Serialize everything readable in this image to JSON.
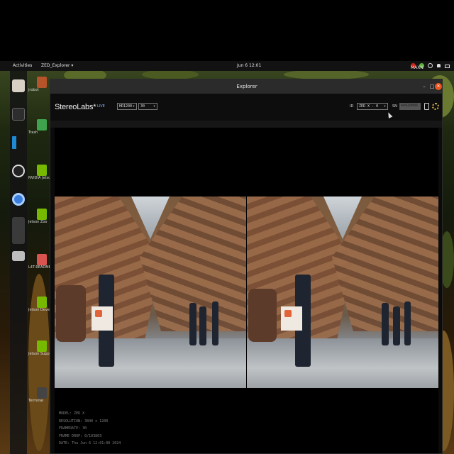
{
  "topbar": {
    "activities": "Activities",
    "app_menu": "ZED_Explorer ▾",
    "clock": "Jun 6  12:01",
    "power_mode": "MAXN"
  },
  "dock": {
    "items": [
      "files-icon",
      "terminal-icon",
      "vscode-icon",
      "obs-icon",
      "chromium-icon",
      "app-icon",
      "drive-icon"
    ]
  },
  "desktop_icons": [
    {
      "label": "jrobot",
      "color": "#c75b2b"
    },
    {
      "label": "Trash",
      "color": "#3fa34d"
    },
    {
      "label": "NVIDIA Jetson Community",
      "color": "#76b900"
    },
    {
      "label": "Jetson Zoo",
      "color": "#76b900"
    },
    {
      "label": "L4T-README",
      "color": "#d9534f"
    },
    {
      "label": "Jetson Developer Z",
      "color": "#76b900"
    },
    {
      "label": "Jetson Support Forums",
      "color": "#76b900"
    },
    {
      "label": "Terminal",
      "color": "#444444"
    }
  ],
  "window": {
    "title": "Explorer",
    "minimize": "–",
    "maximize": "□",
    "close": "✕"
  },
  "header": {
    "brand": "StereoLabs*",
    "live": "LIVE",
    "resolution": "HD1200",
    "fps": "30",
    "id_label": "ID",
    "id_value": "ZED X - 0",
    "sn_label": "SN",
    "sn_value": "44920806"
  },
  "info": {
    "model": "MODEL: ZED X",
    "resolution": "RESOLUTION: 3840 x 1200",
    "framerate": "FRAMERATE: 30",
    "frame_drop": "FRAME DROP: 0/103803",
    "date": "DATE: Thu Jun 6 12:01:00 2024"
  }
}
